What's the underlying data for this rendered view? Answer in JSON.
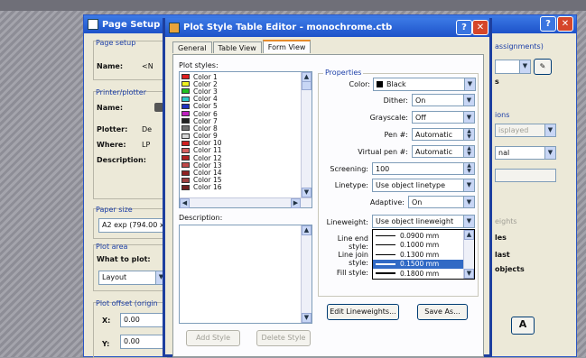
{
  "page_setup": {
    "title": "Page Setup - L",
    "page_setup_group": "Page setup",
    "name_label": "Name:",
    "name_value": "<N",
    "printer_group": "Printer/plotter",
    "printer_name_label": "Name:",
    "plotter_label": "Plotter:",
    "plotter_value": "De",
    "where_label": "Where:",
    "where_value": "LP",
    "description_label": "Description:",
    "paper_size_group": "Paper size",
    "paper_size_value": "A2 exp (794.00 x",
    "plot_area_group": "Plot area",
    "what_to_plot_label": "What to plot:",
    "what_to_plot_value": "Layout",
    "plot_offset_group": "Plot offset (origin",
    "x_label": "X:",
    "x_value": "0.00",
    "y_label": "Y:",
    "y_value": "0.00",
    "right_assignments": "assignments)",
    "right_options": "ions",
    "right_displayed": "isplayed",
    "right_nal": "nal",
    "right_eights": "eights",
    "right_les": "les",
    "right_last": "last",
    "right_objects": "objects"
  },
  "editor": {
    "title": "Plot Style Table Editor - monochrome.ctb",
    "tabs": [
      "General",
      "Table View",
      "Form View"
    ],
    "plot_styles_label": "Plot styles:",
    "plot_styles": [
      {
        "name": "Color 1",
        "color": "#e02020"
      },
      {
        "name": "Color 2",
        "color": "#f0f020"
      },
      {
        "name": "Color 3",
        "color": "#20c020"
      },
      {
        "name": "Color 4",
        "color": "#30c8c8"
      },
      {
        "name": "Color 5",
        "color": "#2030c0"
      },
      {
        "name": "Color 6",
        "color": "#c020c0"
      },
      {
        "name": "Color 7",
        "color": "#222222"
      },
      {
        "name": "Color 8",
        "color": "#707070"
      },
      {
        "name": "Color 9",
        "color": "#d8d8d8"
      },
      {
        "name": "Color 10",
        "color": "#d02020"
      },
      {
        "name": "Color 11",
        "color": "#d86060"
      },
      {
        "name": "Color 12",
        "color": "#b02020"
      },
      {
        "name": "Color 13",
        "color": "#c04848"
      },
      {
        "name": "Color 14",
        "color": "#902020"
      },
      {
        "name": "Color 15",
        "color": "#a04040"
      },
      {
        "name": "Color 16",
        "color": "#702020"
      }
    ],
    "description_label": "Description:",
    "add_style": "Add Style",
    "delete_style": "Delete Style",
    "properties_label": "Properties",
    "color_label": "Color:",
    "color_value": "Black",
    "dither_label": "Dither:",
    "dither_value": "On",
    "grayscale_label": "Grayscale:",
    "grayscale_value": "Off",
    "pen_label": "Pen #:",
    "pen_value": "Automatic",
    "virtual_pen_label": "Virtual pen #:",
    "virtual_pen_value": "Automatic",
    "screening_label": "Screening:",
    "screening_value": "100",
    "linetype_label": "Linetype:",
    "linetype_value": "Use object linetype",
    "adaptive_label": "Adaptive:",
    "adaptive_value": "On",
    "lineweight_label": "Lineweight:",
    "lineweight_value": "Use object lineweight",
    "line_end_label": "Line end style:",
    "line_join_label": "Line join style:",
    "fill_label": "Fill style:",
    "lineweights": [
      {
        "value": "0.0900 mm",
        "thick": 1
      },
      {
        "value": "0.1000 mm",
        "thick": 1
      },
      {
        "value": "0.1300 mm",
        "thick": 1
      },
      {
        "value": "0.1500 mm",
        "thick": 2
      },
      {
        "value": "0.1800 mm",
        "thick": 2
      }
    ],
    "edit_lineweights": "Edit Lineweights...",
    "save_as": "Save As..."
  },
  "colors": {
    "titlebar": "#1d52c9",
    "selection": "#316ac5",
    "group_label": "#1c3fa8"
  }
}
